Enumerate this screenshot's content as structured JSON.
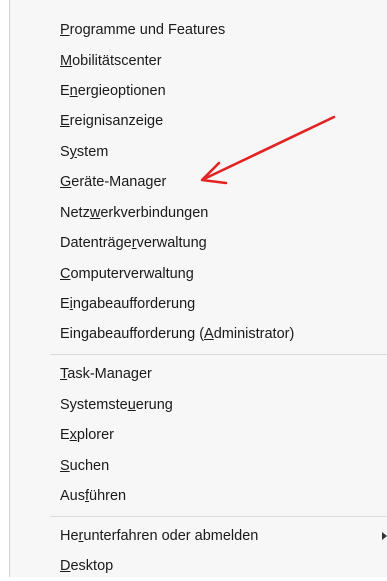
{
  "menu": {
    "group1": [
      {
        "pre": "",
        "u": "P",
        "post": "rogramme und Features"
      },
      {
        "pre": "",
        "u": "M",
        "post": "obilitätscenter"
      },
      {
        "pre": "E",
        "u": "n",
        "post": "ergieoptionen"
      },
      {
        "pre": "",
        "u": "E",
        "post": "reignisanzeige"
      },
      {
        "pre": "S",
        "u": "y",
        "post": "stem"
      },
      {
        "pre": "",
        "u": "G",
        "post": "eräte-Manager"
      },
      {
        "pre": "Netz",
        "u": "w",
        "post": "erkverbindungen"
      },
      {
        "pre": "Datenträge",
        "u": "r",
        "post": "verwaltung"
      },
      {
        "pre": "",
        "u": "C",
        "post": "omputerverwaltung"
      },
      {
        "pre": "E",
        "u": "i",
        "post": "ngabeaufforderung"
      },
      {
        "pre": "Eingabeaufforderung (",
        "u": "A",
        "post": "dministrator)"
      }
    ],
    "group2": [
      {
        "pre": "",
        "u": "T",
        "post": "ask-Manager"
      },
      {
        "pre": "Systemste",
        "u": "u",
        "post": "erung"
      },
      {
        "pre": "E",
        "u": "x",
        "post": "plorer"
      },
      {
        "pre": "",
        "u": "S",
        "post": "uchen"
      },
      {
        "pre": "Aus",
        "u": "f",
        "post": "ühren"
      }
    ],
    "group3": [
      {
        "pre": "He",
        "u": "r",
        "post": "unterfahren oder abmelden"
      },
      {
        "pre": "",
        "u": "D",
        "post": "esktop"
      }
    ]
  },
  "annotation": {
    "arrow_color": "#e32323"
  }
}
